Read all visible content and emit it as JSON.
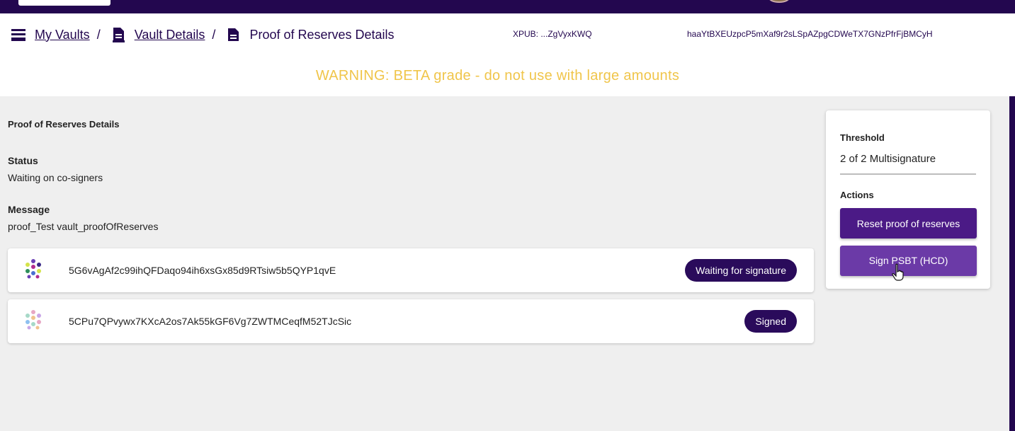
{
  "breadcrumbs": {
    "my_vaults": "My Vaults",
    "vault_details": "Vault Details",
    "proof_details": "Proof of Reserves Details",
    "sep": "/"
  },
  "header": {
    "xpub_short": "XPUB: ...ZgVyxKWQ",
    "xpub_full": "haaYtBXEUzpcP5mXaf9r2sLSpAZpgCDWeTX7GNzPfrFjBMCyH",
    "warning": "WARNING: BETA grade - do not use with large amounts"
  },
  "details": {
    "section_title": "Proof of Reserves Details",
    "status_label": "Status",
    "status_value": "Waiting on co-signers",
    "message_label": "Message",
    "message_value": "proof_Test vault_proofOfReserves"
  },
  "signers": [
    {
      "address": "5G6vAgAf2c99ihQFDaqo94ih6xsGx85d9RTsiw5b5QYP1qvE",
      "status": "Waiting for signature"
    },
    {
      "address": "5CPu7QPvywx7KXcA2os7Ak55kGF6Vg7ZWTMCeqfM52TJcSic",
      "status": "Signed"
    }
  ],
  "sidebar": {
    "threshold_label": "Threshold",
    "threshold_value": "2 of 2 Multisignature",
    "actions_label": "Actions",
    "reset_button": "Reset proof of reserves",
    "sign_button": "Sign PSBT (HCD)"
  },
  "colors": {
    "brand_dark": "#23074f",
    "button_primary": "#4b1a86",
    "button_hover": "#6b3aa7",
    "warning": "#f0c54a",
    "chip": "#2a0b5b"
  },
  "icons": {
    "vaults": "list-icon",
    "vault_details": "document-icon",
    "proof": "document-icon",
    "signer_identicon": "polkadot-identicon",
    "cursor": "hand-pointer-icon"
  }
}
